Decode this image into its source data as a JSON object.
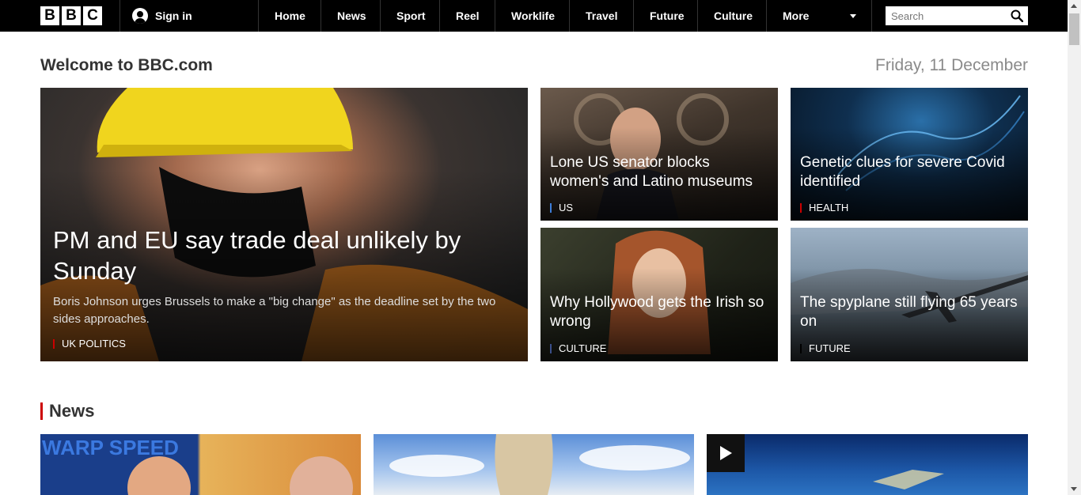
{
  "logo": {
    "letters": [
      "B",
      "B",
      "C"
    ]
  },
  "signin": {
    "label": "Sign in"
  },
  "nav": {
    "items": [
      "Home",
      "News",
      "Sport",
      "Reel",
      "Worklife",
      "Travel",
      "Future",
      "Culture"
    ],
    "more_label": "More"
  },
  "search": {
    "placeholder": "Search"
  },
  "welcome": {
    "title": "Welcome to BBC.com",
    "date": "Friday, 11 December"
  },
  "stories": {
    "main": {
      "headline": "PM and EU say trade deal unlikely by Sunday",
      "summary": "Boris Johnson urges Brussels to make a \"big change\" as the deadline set by the two sides approaches.",
      "tag": "UK POLITICS",
      "tag_color": "#cc0000"
    },
    "senator": {
      "headline": "Lone US senator blocks women's and Latino museums",
      "tag": "US",
      "tag_color": "#3d7dd8"
    },
    "genetic": {
      "headline": "Genetic clues for severe Covid identified",
      "tag": "HEALTH",
      "tag_color": "#cc0000"
    },
    "hollywood": {
      "headline": "Why Hollywood gets the Irish so wrong",
      "tag": "CULTURE",
      "tag_color": "#3a4f8a"
    },
    "spyplane": {
      "headline": "The spyplane still flying 65 years on",
      "tag": "FUTURE",
      "tag_color": "#000000"
    }
  },
  "news_section": {
    "title": "News"
  },
  "colors": {
    "topbar": "#000000",
    "accent": "#cc0000",
    "heading": "#333333",
    "date": "#8a8a8a"
  }
}
